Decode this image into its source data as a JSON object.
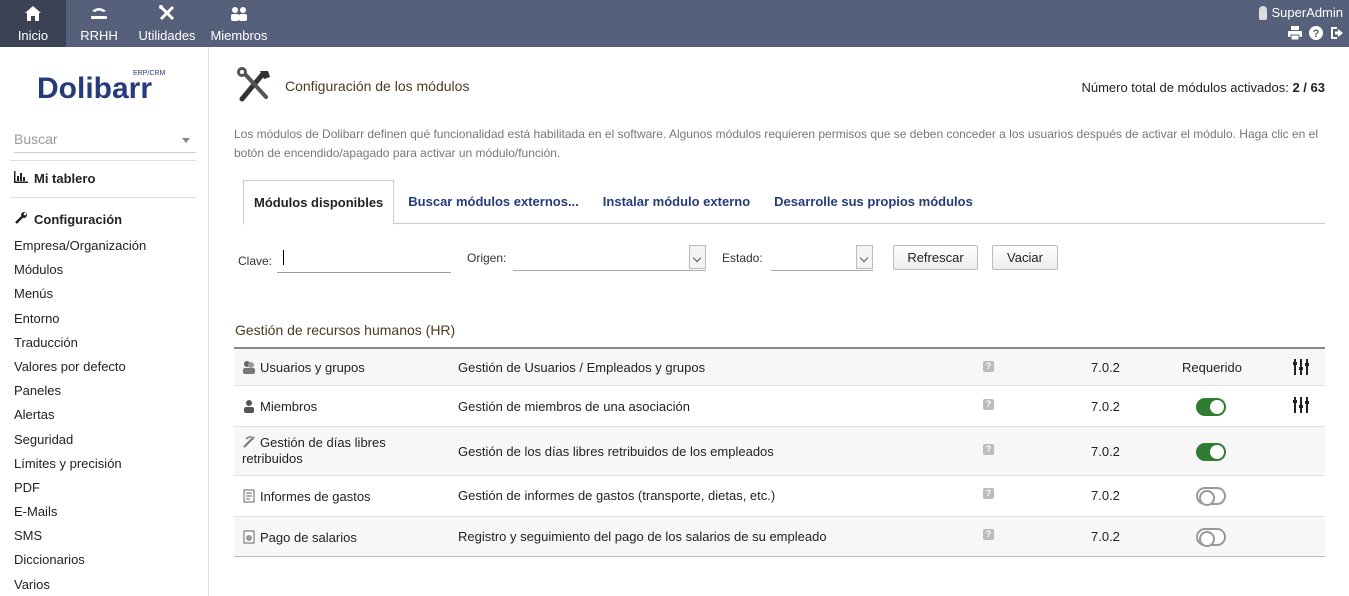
{
  "topmenu": {
    "items": [
      {
        "label": "Inicio",
        "icon": "home-icon",
        "active": true
      },
      {
        "label": "RRHH",
        "icon": "hr-icon"
      },
      {
        "label": "Utilidades",
        "icon": "tools-icon"
      },
      {
        "label": "Miembros",
        "icon": "members-icon"
      }
    ],
    "user": "SuperAdmin"
  },
  "sidebar": {
    "logo": "Dolibarr",
    "logo_sub": "ERP/CRM",
    "search_placeholder": "Buscar",
    "dashboard": "Mi tablero",
    "config_title": "Configuración",
    "items": [
      "Empresa/Organización",
      "Módulos",
      "Menús",
      "Entorno",
      "Traducción",
      "Valores por defecto",
      "Paneles",
      "Alertas",
      "Seguridad",
      "Límites y precisión",
      "PDF",
      "E-Mails",
      "SMS",
      "Diccionarios",
      "Varios"
    ]
  },
  "main": {
    "title": "Configuración de los módulos",
    "total_label": "Número total de módulos activados:",
    "total_value": "2 / 63",
    "description": "Los módulos de Dolibarr definen qué funcionalidad está habilitada en el software. Algunos módulos requieren permisos que se deben conceder a los usuarios después de activar el módulo. Haga clic en el botón de encendido/apagado para activar un módulo/función.",
    "tabs": [
      "Módulos disponibles",
      "Buscar módulos externos...",
      "Instalar módulo externo",
      "Desarrolle sus propios módulos"
    ],
    "filters": {
      "key_label": "Clave:",
      "origin_label": "Origen:",
      "state_label": "Estado:",
      "refresh": "Refrescar",
      "clear": "Vaciar"
    },
    "section_title": "Gestión de recursos humanos (HR)",
    "modules": [
      {
        "name": "Usuarios y grupos",
        "desc": "Gestión de Usuarios / Empleados y grupos",
        "version": "7.0.2",
        "status": "Requerido",
        "icon": "users-group-icon",
        "setup": true
      },
      {
        "name": "Miembros",
        "desc": "Gestión de miembros de una asociación",
        "version": "7.0.2",
        "status": "on",
        "icon": "member-icon",
        "setup": true
      },
      {
        "name": "Gestión de días libres retribuidos",
        "desc": "Gestión de los días libres retribuidos de los empleados",
        "version": "7.0.2",
        "status": "on",
        "icon": "holiday-icon",
        "setup": false
      },
      {
        "name": "Informes de gastos",
        "desc": "Gestión de informes de gastos (transporte, dietas, etc.)",
        "version": "7.0.2",
        "status": "off",
        "icon": "expense-report-icon",
        "setup": false
      },
      {
        "name": "Pago de salarios",
        "desc": "Registro y seguimiento del pago de los salarios de su empleado",
        "version": "7.0.2",
        "status": "off",
        "icon": "salary-icon",
        "setup": false
      }
    ]
  },
  "colors": {
    "topbar": "#56607a",
    "toggle_on": "#2e7d32",
    "tab_link": "#263c7a",
    "title_brown": "#4e3a1f"
  }
}
